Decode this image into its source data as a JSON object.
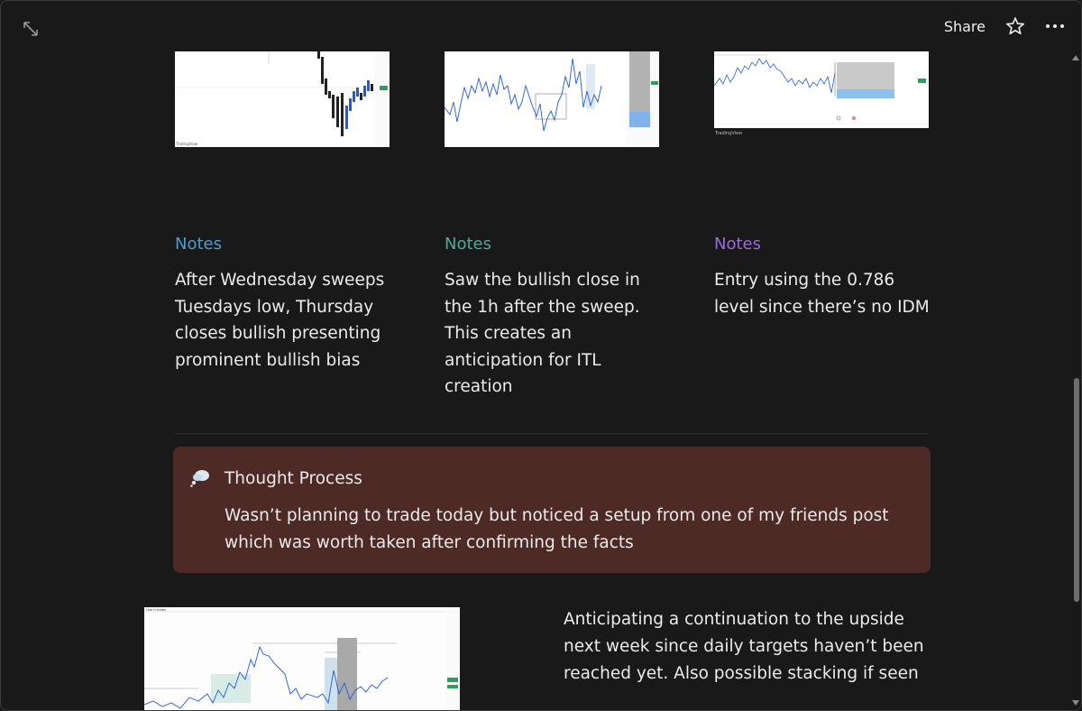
{
  "topbar": {
    "expand_icon": "expand-diagonal-icon",
    "share_label": "Share",
    "star_icon": "star-icon",
    "more_icon": "more-horizontal-icon"
  },
  "thumbnails": {
    "brand": "TradingView"
  },
  "columns": [
    {
      "heading": "Notes",
      "color": "#529cca",
      "body": "After Wednesday sweeps Tuesdays low, Thursday closes bullish presenting prominent bullish bias"
    },
    {
      "heading": "Notes",
      "color": "#4dab9a",
      "body": "Saw the bullish close in the 1h after the sweep. This creates an anticipation for ITL creation"
    },
    {
      "heading": "Notes",
      "color": "#9a6dd7",
      "body": "Entry using the 0.786 level since there’s no IDM"
    }
  ],
  "callout": {
    "icon": "thought-bubble-icon",
    "title": "Thought Process",
    "body": "Wasn’t planning to trade today but noticed a setup from one of my friends post which was worth taken after confirming the facts",
    "background": "#4e2a26"
  },
  "bottom": {
    "text": "Anticipating a continuation to the upside next week since daily targets haven’t been reached yet. Also possible stacking if seen"
  }
}
